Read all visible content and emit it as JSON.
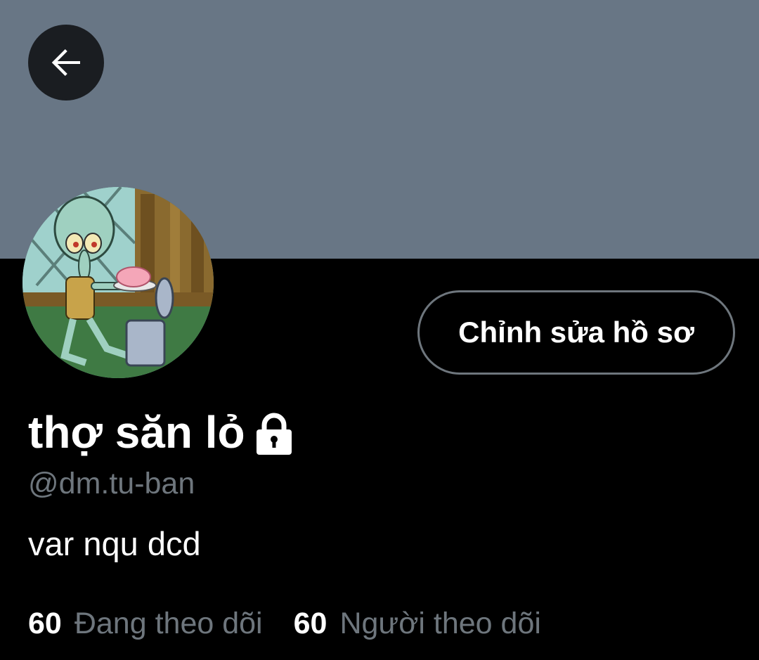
{
  "colors": {
    "banner": "#687685",
    "background": "#000000",
    "muted_text": "#6e767d",
    "primary_text": "#ffffff",
    "button_border": "#6e767d"
  },
  "header": {
    "back_icon": "arrow-left-icon"
  },
  "profile": {
    "edit_button_label": "Chỉnh sửa hồ sơ",
    "display_name": "thợ săn lỏ",
    "lock_icon": "lock-icon",
    "handle": "@dm.tu-ban",
    "bio": "var nqu dcd"
  },
  "stats": {
    "following_count": "60",
    "following_label": "Đang theo dõi",
    "followers_count": "60",
    "followers_label": "Người theo dõi"
  }
}
